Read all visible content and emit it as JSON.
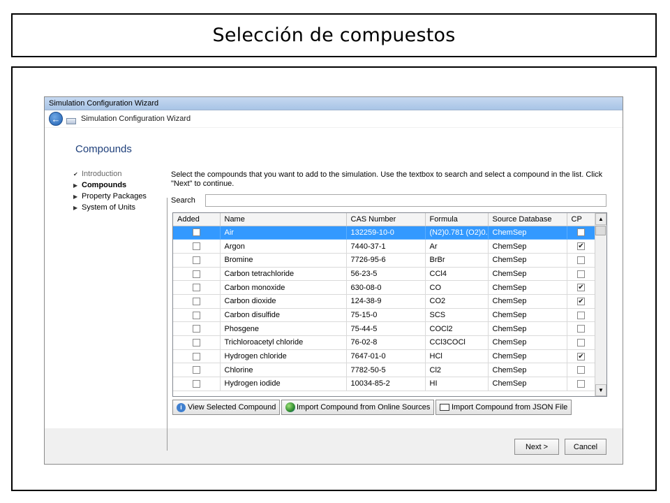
{
  "slide": {
    "title": "Selección de compuestos"
  },
  "window": {
    "title": "Simulation Configuration Wizard",
    "header_title": "Simulation Configuration Wizard"
  },
  "page": {
    "heading": "Compounds",
    "steps": [
      {
        "label": "Introduction",
        "state": "done"
      },
      {
        "label": "Compounds",
        "state": "current"
      },
      {
        "label": "Property Packages",
        "state": "pending"
      },
      {
        "label": "System of Units",
        "state": "pending"
      }
    ],
    "instructions": "Select the compounds that you want to add to the simulation. Use the textbox to search and select a compound in the list. Click \"Next\" to continue.",
    "search_label": "Search",
    "search_value": ""
  },
  "grid": {
    "columns": [
      "Added",
      "Name",
      "CAS Number",
      "Formula",
      "Source Database",
      "CP"
    ],
    "rows": [
      {
        "added": false,
        "name": "Air",
        "cas": "132259-10-0",
        "formula": "(N2)0.781 (O2)0...",
        "source": "ChemSep",
        "cp": false,
        "selected": true
      },
      {
        "added": false,
        "name": "Argon",
        "cas": "7440-37-1",
        "formula": "Ar",
        "source": "ChemSep",
        "cp": true
      },
      {
        "added": false,
        "name": "Bromine",
        "cas": "7726-95-6",
        "formula": "BrBr",
        "source": "ChemSep",
        "cp": false
      },
      {
        "added": false,
        "name": "Carbon tetrachloride",
        "cas": "56-23-5",
        "formula": "CCl4",
        "source": "ChemSep",
        "cp": false
      },
      {
        "added": false,
        "name": "Carbon monoxide",
        "cas": "630-08-0",
        "formula": "CO",
        "source": "ChemSep",
        "cp": true
      },
      {
        "added": false,
        "name": "Carbon dioxide",
        "cas": "124-38-9",
        "formula": "CO2",
        "source": "ChemSep",
        "cp": true
      },
      {
        "added": false,
        "name": "Carbon disulfide",
        "cas": "75-15-0",
        "formula": "SCS",
        "source": "ChemSep",
        "cp": false
      },
      {
        "added": false,
        "name": "Phosgene",
        "cas": "75-44-5",
        "formula": "COCl2",
        "source": "ChemSep",
        "cp": false
      },
      {
        "added": false,
        "name": "Trichloroacetyl chloride",
        "cas": "76-02-8",
        "formula": "CCl3COCl",
        "source": "ChemSep",
        "cp": false
      },
      {
        "added": false,
        "name": "Hydrogen chloride",
        "cas": "7647-01-0",
        "formula": "HCl",
        "source": "ChemSep",
        "cp": true
      },
      {
        "added": false,
        "name": "Chlorine",
        "cas": "7782-50-5",
        "formula": "Cl2",
        "source": "ChemSep",
        "cp": false
      },
      {
        "added": false,
        "name": "Hydrogen iodide",
        "cas": "10034-85-2",
        "formula": "HI",
        "source": "ChemSep",
        "cp": false
      }
    ]
  },
  "actions": {
    "view_selected": "View Selected Compound",
    "import_online": "Import Compound from Online Sources",
    "import_json": "Import Compound from JSON File"
  },
  "footer": {
    "next": "Next >",
    "cancel": "Cancel"
  },
  "icons": {
    "back": "back-arrow-icon",
    "wizard": "wizard-window-icon",
    "info": "info-icon",
    "globe": "globe-icon",
    "file": "file-icon"
  },
  "colors": {
    "selection": "#3399ff",
    "heading": "#1e3f7a",
    "titlebar": "#b8cfeb"
  }
}
